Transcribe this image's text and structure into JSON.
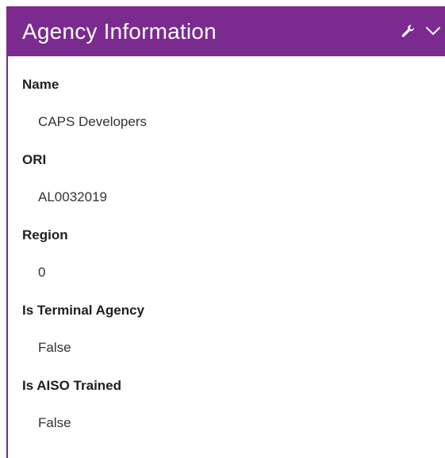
{
  "panel": {
    "title": "Agency Information",
    "icons": [
      "wrench-icon",
      "chevron-down-icon"
    ],
    "accent_color": "#7b2a90"
  },
  "fields": [
    {
      "label": "Name",
      "value": "CAPS Developers"
    },
    {
      "label": "ORI",
      "value": "AL0032019"
    },
    {
      "label": "Region",
      "value": "0"
    },
    {
      "label": "Is Terminal Agency",
      "value": "False"
    },
    {
      "label": "Is AISO Trained",
      "value": "False"
    }
  ]
}
